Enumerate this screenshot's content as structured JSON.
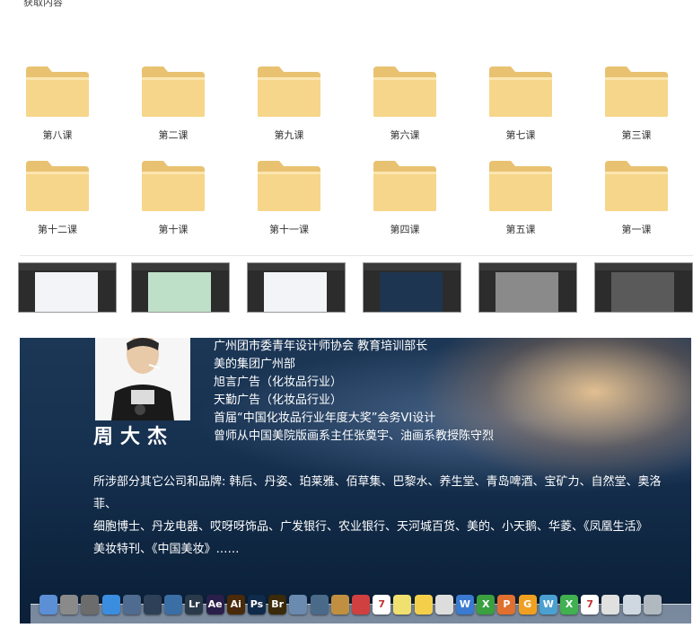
{
  "top": {
    "crumb": "获取内容"
  },
  "folders": [
    {
      "label": "第八课"
    },
    {
      "label": "第二课"
    },
    {
      "label": "第九课"
    },
    {
      "label": "第六课"
    },
    {
      "label": "第七课"
    },
    {
      "label": "第三课"
    },
    {
      "label": "第十二课"
    },
    {
      "label": "第十课"
    },
    {
      "label": "第十一课"
    },
    {
      "label": "第四课"
    },
    {
      "label": "第五课"
    },
    {
      "label": "第一课"
    }
  ],
  "colors": {
    "folder": "#f6d68a",
    "folder_dark": "#e9c271",
    "banner_text": "#ffffff"
  },
  "profile": {
    "name": "周大杰",
    "bio_lines": [
      "广州团市委青年设计师协会  教育培训部长",
      "美的集团广州部",
      "旭言广告（化妆品行业）",
      "天勤广告（化妆品行业）",
      "首届“中国化妆品行业年度大奖”会务VI设计",
      "曾师从中国美院版画系主任张奠宇、油画系教授陈守烈"
    ],
    "clients_lines": [
      "所涉部分其它公司和品牌: 韩后、丹姿、珀莱雅、佰草集、巴黎水、养生堂、青岛啤酒、宝矿力、自然堂、奥洛菲、",
      "细胞博士、丹龙电器、哎呀呀饰品、广发银行、农业银行、天河城百货、美的、小天鹅、华菱、《凤凰生活》",
      "美妆特刊、《中国美妆》……"
    ]
  },
  "dock": {
    "icons": [
      {
        "name": "finder-icon",
        "text": "",
        "color": "#5b8fd6"
      },
      {
        "name": "system-icon",
        "text": "",
        "color": "#8a8a8a"
      },
      {
        "name": "settings-icon",
        "text": "",
        "color": "#6c6c6c"
      },
      {
        "name": "safari-icon",
        "text": "",
        "color": "#3b8de0"
      },
      {
        "name": "mail-icon",
        "text": "",
        "color": "#4f6b8f"
      },
      {
        "name": "app-icon",
        "text": "",
        "color": "#2e4057"
      },
      {
        "name": "upload-icon",
        "text": "",
        "color": "#3a6ea5"
      },
      {
        "name": "lightroom-icon",
        "text": "Lr",
        "color": "#2a3a4a"
      },
      {
        "name": "after-effects-icon",
        "text": "Ae",
        "color": "#2a1f4a"
      },
      {
        "name": "illustrator-icon",
        "text": "Ai",
        "color": "#4a2a0a"
      },
      {
        "name": "photoshop-icon",
        "text": "Ps",
        "color": "#0f2a4a"
      },
      {
        "name": "bridge-icon",
        "text": "Br",
        "color": "#3a2a0a"
      },
      {
        "name": "photo-icon",
        "text": "",
        "color": "#6a8ab0"
      },
      {
        "name": "screen-icon",
        "text": "",
        "color": "#4a6a8a"
      },
      {
        "name": "folder-icon",
        "text": "",
        "color": "#c09040"
      },
      {
        "name": "chrome-icon",
        "text": "",
        "color": "#d04040"
      },
      {
        "name": "calendar-icon",
        "text": "7",
        "color": "#ffffff"
      },
      {
        "name": "notes-icon",
        "text": "",
        "color": "#f0e070"
      },
      {
        "name": "stickies-icon",
        "text": "",
        "color": "#f4d04a"
      },
      {
        "name": "doc-icon",
        "text": "",
        "color": "#dddddd"
      },
      {
        "name": "word-icon",
        "text": "W",
        "color": "#3a7ad0"
      },
      {
        "name": "excel-icon",
        "text": "X",
        "color": "#3aa040"
      },
      {
        "name": "powerpoint-icon",
        "text": "P",
        "color": "#e07030"
      },
      {
        "name": "image-icon",
        "text": "G",
        "color": "#f0a020"
      },
      {
        "name": "word2-icon",
        "text": "W",
        "color": "#4aa0d0"
      },
      {
        "name": "excel2-icon",
        "text": "X",
        "color": "#40b050"
      },
      {
        "name": "calendar2-icon",
        "text": "7",
        "color": "#ffffff"
      },
      {
        "name": "misc-icon",
        "text": "",
        "color": "#e0e0e0"
      },
      {
        "name": "preview-icon",
        "text": "",
        "color": "#cfd8e0"
      },
      {
        "name": "trash-icon",
        "text": "",
        "color": "#b0b8c0"
      }
    ]
  }
}
